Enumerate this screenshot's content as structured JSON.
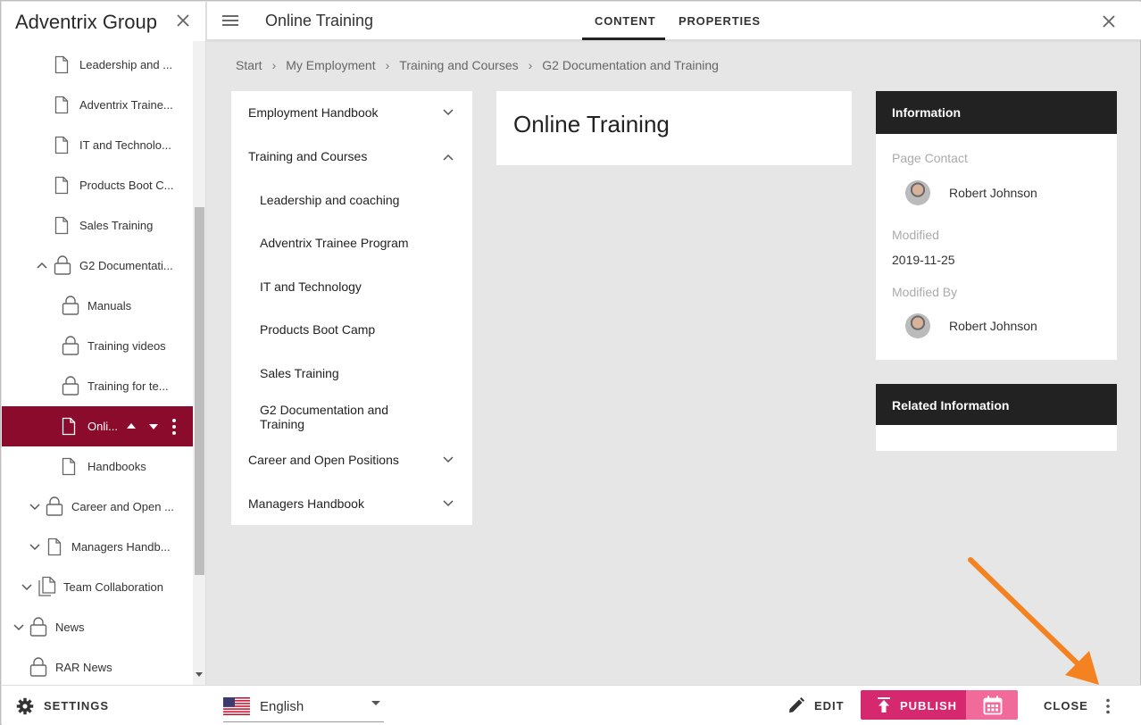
{
  "app": {
    "title": "Adventrix Group"
  },
  "tree": {
    "items": [
      {
        "label": "Leadership and coaching",
        "icon": "page-icon",
        "indent": 1
      },
      {
        "label": "Adventrix Trainee Program",
        "icon": "page-icon",
        "indent": 1
      },
      {
        "label": "IT and Technology",
        "icon": "page-icon",
        "indent": 1
      },
      {
        "label": "Products Boot Camp",
        "icon": "page-icon",
        "indent": 1
      },
      {
        "label": "Sales Training",
        "icon": "page-icon",
        "indent": 1
      },
      {
        "label": "G2 Documentation and Training",
        "icon": "lock-icon",
        "indent": 1,
        "expanded": true
      },
      {
        "label": "Manuals",
        "icon": "lock-icon",
        "indent": 2
      },
      {
        "label": "Training videos",
        "icon": "lock-icon",
        "indent": 2
      },
      {
        "label": "Training for teams",
        "icon": "lock-icon",
        "indent": 2
      },
      {
        "label": "Online Training",
        "icon": "page-icon",
        "indent": 2,
        "selected": true
      },
      {
        "label": "Handbooks",
        "icon": "page-icon",
        "indent": 2
      },
      {
        "label": "Career and Open Positions",
        "icon": "lock-icon",
        "indent": 1,
        "collapsed": true
      },
      {
        "label": "Managers Handbook",
        "icon": "page-icon",
        "indent": 1,
        "collapsed": true
      },
      {
        "label": "Team Collaboration",
        "icon": "pages-icon",
        "indent": 0,
        "collapsed": true
      },
      {
        "label": "News",
        "icon": "lock-icon",
        "indent": -1,
        "collapsed": true
      },
      {
        "label": "RAR News",
        "icon": "lock-icon",
        "indent": -1
      }
    ],
    "display": {
      "leadership": "Leadership and ...",
      "trainee": "Adventrix Traine...",
      "it": "IT and Technolo...",
      "boot": "Products Boot C...",
      "sales": "Sales Training",
      "g2": "G2 Documentati...",
      "manuals": "Manuals",
      "videos": "Training videos",
      "teams": "Training for te...",
      "online": "Onli...",
      "handbooks": "Handbooks",
      "career": "Career and Open ...",
      "managers": "Managers Handb...",
      "team": "Team Collaboration",
      "news": "News",
      "rar": "RAR News"
    },
    "selected_color": "#8a0b2b"
  },
  "topbar": {
    "page_name": "Online Training",
    "tabs": [
      {
        "label": "CONTENT",
        "active": true
      },
      {
        "label": "PROPERTIES",
        "active": false
      }
    ]
  },
  "breadcrumb": [
    "Start",
    "My Employment",
    "Training and Courses",
    "G2 Documentation and Training"
  ],
  "nav": {
    "items": [
      {
        "label": "Employment Handbook",
        "toggle": "expand"
      },
      {
        "label": "Training and Courses",
        "toggle": "collapse"
      },
      {
        "label": "Leadership and coaching"
      },
      {
        "label": "Adventrix Trainee Program"
      },
      {
        "label": "IT and Technology"
      },
      {
        "label": "Products Boot Camp"
      },
      {
        "label": "Sales Training"
      },
      {
        "label": "G2 Documentation and Training"
      },
      {
        "label": "Career and Open Positions",
        "toggle": "expand"
      },
      {
        "label": "Managers Handbook",
        "toggle": "expand"
      }
    ]
  },
  "main": {
    "title": "Online Training"
  },
  "info": {
    "heading": "Information",
    "page_contact_label": "Page Contact",
    "page_contact": "Robert Johnson",
    "modified_label": "Modified",
    "modified": "2019-11-25",
    "modified_by_label": "Modified By",
    "modified_by": "Robert Johnson"
  },
  "related": {
    "heading": "Related Information"
  },
  "bottombar": {
    "settings_label": "SETTINGS",
    "language": "English",
    "edit_label": "EDIT",
    "publish_label": "PUBLISH",
    "close_label": "CLOSE",
    "publish_color": "#d6286e",
    "schedule_color": "#f06b9a"
  },
  "annotation_color": "#f58220"
}
